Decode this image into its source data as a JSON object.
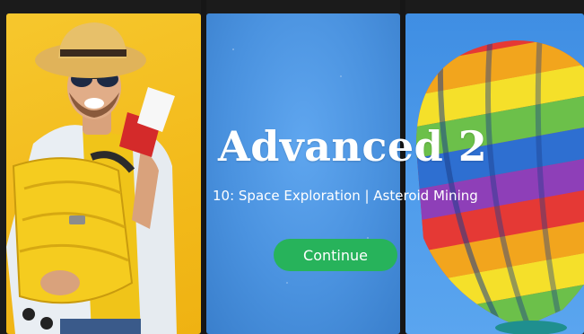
{
  "lesson": {
    "title": "Advanced 2",
    "subtitle": "10: Space Exploration  |  Asteroid Mining"
  },
  "actions": {
    "continue_label": "Continue"
  },
  "images": {
    "left_panel": "traveler-with-suitcase-and-passport",
    "middle_panel": "sky-texture",
    "right_panel": "hot-air-balloon"
  },
  "colors": {
    "yellow_panel": "#f3bb1c",
    "sky_blue": "#4a92df",
    "button_green": "#27b35b",
    "frame_dark": "#1b1b1b"
  }
}
